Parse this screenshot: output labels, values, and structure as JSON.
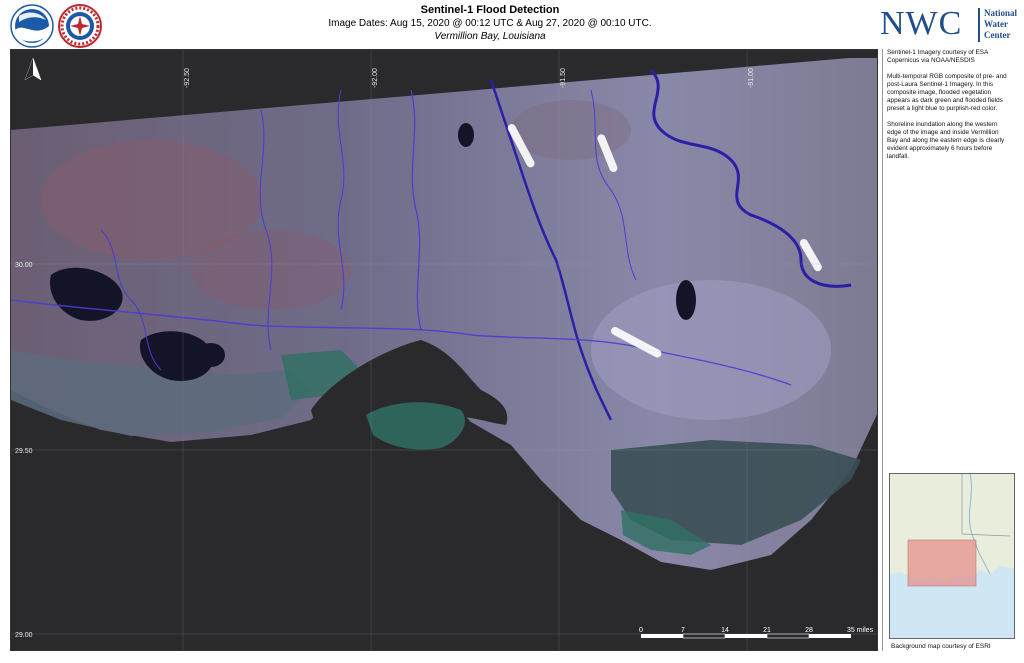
{
  "header": {
    "title": "Sentinel-1 Flood Detection",
    "dates": "Image Dates: Aug 15, 2020 @ 00:12 UTC & Aug 27, 2020 @ 00:10 UTC.",
    "location": "Vermillion Bay, Louisiana"
  },
  "brand": {
    "nwc_big": "NWC",
    "nwc_line1": "National",
    "nwc_line2": "Water",
    "nwc_line3": "Center",
    "color": "#1f4e89"
  },
  "panel": {
    "credit": "Sentinel-1 Imagery courtesy of ESA Copernicus via NOAA/NESDIS",
    "description": "Multi-temporal RGB composite of pre- and post-Laura Sentinel-1 Imagery.  In this composite image, flooded vegetation appears as dark green and flooded fields preset a light blue to purplish-red color.",
    "shoreline": "Shoreline inundation along the western edge of the image and inside Vermillion Bay and along the eastern edge is clearly evident approximately 6 hours before landfall.",
    "basemap_credit": "Background map courtesy of ESRI"
  },
  "map": {
    "longitudes": [
      "-92.50",
      "-92.00",
      "-91.50",
      "-91.00"
    ],
    "latitudes": [
      "30.00",
      "29.50",
      "29.00"
    ],
    "scale": {
      "ticks": [
        "0",
        "7",
        "14",
        "21",
        "28"
      ],
      "last": "35 miles"
    },
    "north_symbol": "north-arrow"
  },
  "colors": {
    "water": "#2a2a2c",
    "land": "#6f6d8a",
    "rivers": "#4b3bd6",
    "flood_light": "#9aa0c9",
    "flood_green": "#2f6f63"
  }
}
